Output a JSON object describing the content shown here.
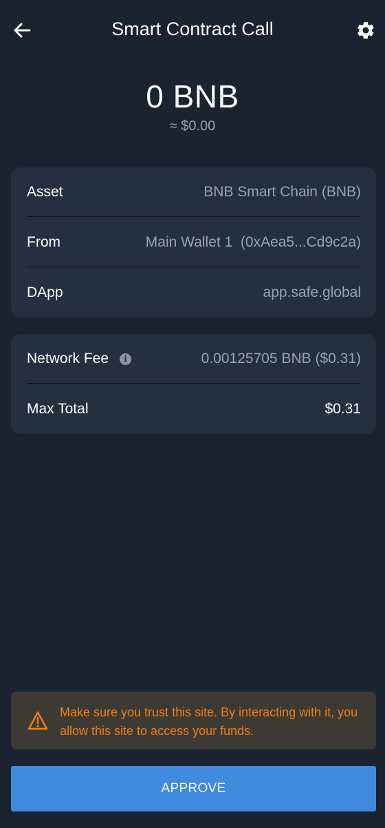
{
  "header": {
    "title": "Smart Contract Call",
    "back_icon": "arrow-left-icon",
    "settings_icon": "gear-icon"
  },
  "amount": {
    "value": "0 BNB",
    "fiat": "≈ $0.00"
  },
  "details": {
    "asset_label": "Asset",
    "asset_value": "BNB Smart Chain (BNB)",
    "from_label": "From",
    "from_value": "Main Wallet 1  (0xAea5...Cd9c2a)",
    "dapp_label": "DApp",
    "dapp_value": "app.safe.global"
  },
  "fees": {
    "network_fee_label": "Network Fee",
    "network_fee_value": "0.00125705 BNB ($0.31)",
    "max_total_label": "Max Total",
    "max_total_value": "$0.31"
  },
  "warning": {
    "icon": "warning-triangle-icon",
    "text": "Make sure you trust this site. By interacting with it, you allow this site to access your funds."
  },
  "approve_label": "APPROVE",
  "colors": {
    "background": "#1b2230",
    "card": "#243040",
    "muted_text": "#98a3b4",
    "warning_bg": "#3d3a33",
    "warning_text": "#f07f17",
    "accent": "#408ae0"
  }
}
